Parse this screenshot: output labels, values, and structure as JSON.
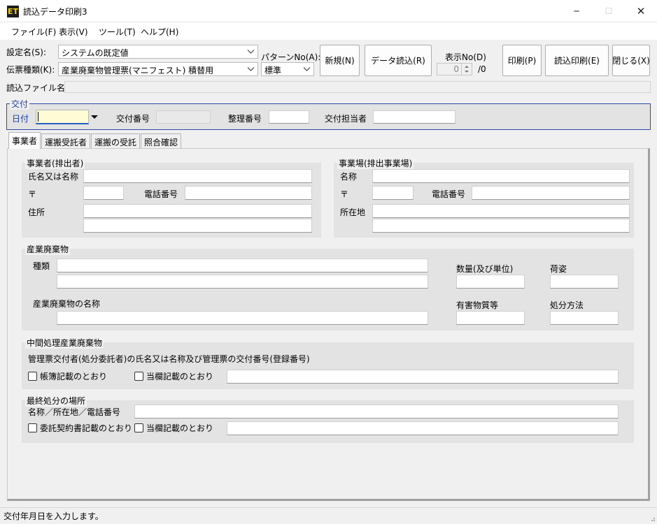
{
  "window": {
    "title": "読込データ印刷3",
    "icon_name": "app-logo-icon",
    "icon_glyph": "ET",
    "minimize": "─",
    "maximize": "☐",
    "close": "✕"
  },
  "menu": [
    "ファイル(F)",
    "表示(V)",
    "ツール(T)",
    "ヘルプ(H)"
  ],
  "toolbar": {
    "setting_label": "設定名(S):",
    "setting_value": "システムの既定値",
    "slip_label": "伝票種類(K):",
    "slip_value": "産業廃棄物管理票(マニフェスト) 積替用",
    "pattern_label": "パターンNo(A):",
    "pattern_value": "標準",
    "new_button": "新規(N)",
    "load_button": "データ読込(R)",
    "display_no_label": "表示No(D)",
    "display_no_value": "0",
    "display_no_total": "/0",
    "print_button": "印刷(P)",
    "load_print_button": "読込印刷(E)",
    "close_button": "閉じる(X)",
    "file_label": "読込ファイル名",
    "file_value": ""
  },
  "koufu": {
    "group_title": "交付",
    "date_label": "日付",
    "date_value": "",
    "number_label": "交付番号",
    "seiri_label": "整理番号",
    "tantou_label": "交付担当者"
  },
  "tabs": [
    "事業者",
    "運搬受託者",
    "運搬の受託",
    "照合確認"
  ],
  "jigyousha": {
    "title": "事業者(排出者)",
    "name_label": "氏名又は名称",
    "postal_label": "〒",
    "phone_label": "電話番号",
    "address_label": "住所"
  },
  "jigyoujou": {
    "title": "事業場(排出事業場)",
    "name_label": "名称",
    "postal_label": "〒",
    "phone_label": "電話番号",
    "address_label": "所在地"
  },
  "waste": {
    "title": "産業廃棄物",
    "type_label": "種類",
    "name_label": "産業廃棄物の名称",
    "quantity_label": "数量(及び単位)",
    "packing_label": "荷姿",
    "hazard_label": "有害物質等",
    "disposal_label": "処分方法"
  },
  "intermediate": {
    "title": "中間処理産業廃棄物",
    "desc": "管理票交付者(処分委託者)の氏名又は名称及び管理票の交付番号(登録番号)",
    "cb1_label": "帳簿記載のとおり",
    "cb2_label": "当欄記載のとおり"
  },
  "final": {
    "title": "最終処分の場所",
    "desc": "名称／所在地／電話番号",
    "cb1_label": "委託契約書記載のとおり",
    "cb2_label": "当欄記載のとおり"
  },
  "status": "交付年月日を入力します。"
}
